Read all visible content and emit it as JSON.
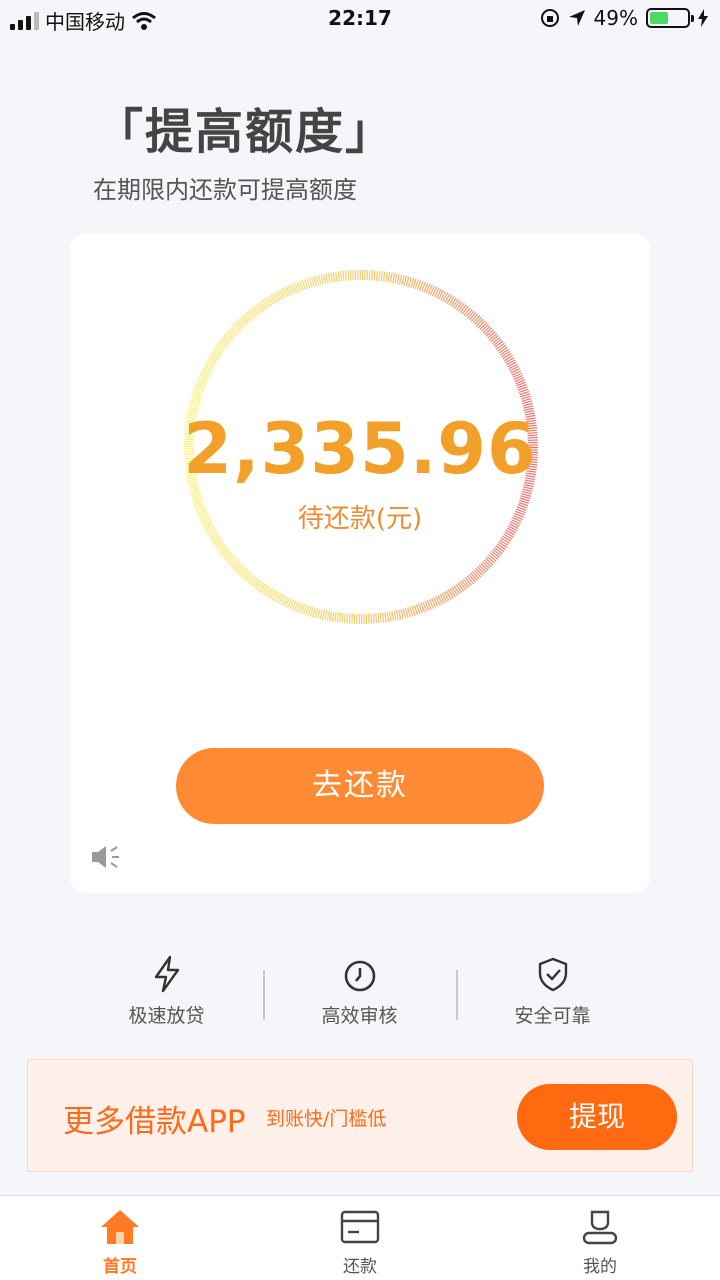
{
  "status_bar": {
    "carrier": "中国移动",
    "time": "22:17",
    "battery": "49%",
    "battery_level": 0.49
  },
  "header": {
    "title": "「提高额度」",
    "subtitle": "在期限内还款可提高额度"
  },
  "repayment_card": {
    "amount": "2,335.96",
    "amount_label": "待还款(元)",
    "repay_button_label": "去还款",
    "colors": {
      "ring_start": "#fff176",
      "ring_end": "#ef6f6f",
      "amount": "#f2a02a",
      "button": "#ff8a34"
    }
  },
  "features": [
    {
      "label": "极速放贷",
      "icon": "lightning-icon"
    },
    {
      "label": "高效审核",
      "icon": "clock-icon"
    },
    {
      "label": "安全可靠",
      "icon": "shield-check-icon"
    }
  ],
  "promo": {
    "title": "更多借款APP",
    "subtitle": "到账快/门槛低",
    "button_label": "提现"
  },
  "tab_bar": {
    "tabs": [
      {
        "label": "首页",
        "icon": "home-icon",
        "active": true
      },
      {
        "label": "还款",
        "icon": "card-icon",
        "active": false
      },
      {
        "label": "我的",
        "icon": "user-icon",
        "active": false
      }
    ]
  }
}
